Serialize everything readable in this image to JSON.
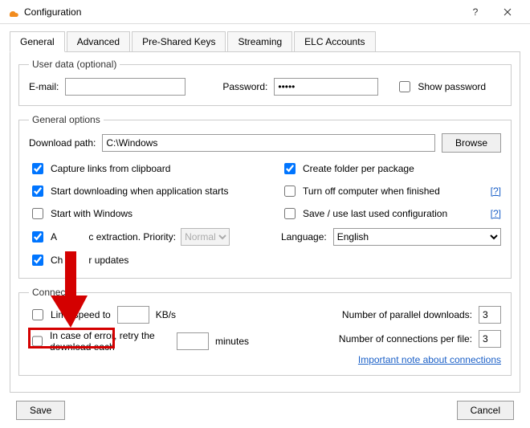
{
  "window": {
    "title": "Configuration"
  },
  "tabs": [
    "General",
    "Advanced",
    "Pre-Shared Keys",
    "Streaming",
    "ELC Accounts"
  ],
  "active_tab": 0,
  "userdata": {
    "legend": "User data (optional)",
    "email_label": "E-mail:",
    "email_value": "",
    "password_label": "Password:",
    "password_value": "•••••",
    "show_password_label": "Show password",
    "show_password_checked": false
  },
  "general": {
    "legend": "General options",
    "download_path_label": "Download path:",
    "download_path_value": "C:\\Windows",
    "browse_label": "Browse",
    "left_opts": [
      {
        "label": "Capture links from clipboard",
        "checked": true
      },
      {
        "label": "Start downloading when application starts",
        "checked": true
      },
      {
        "label": "Start with Windows",
        "checked": false
      }
    ],
    "auto_extract": {
      "label_pre": "A",
      "label_mid": "c extraction. Priority:",
      "checked": true,
      "priority": "Normal",
      "disabled": true
    },
    "check_updates": {
      "label_pre": "Ch",
      "label_post": "r updates",
      "checked": true
    },
    "right_opts": [
      {
        "label": "Create folder per package",
        "checked": true,
        "help": false
      },
      {
        "label": "Turn off computer when finished",
        "checked": false,
        "help": true
      },
      {
        "label": "Save / use last used configuration",
        "checked": false,
        "help": true
      }
    ],
    "language_label": "Language:",
    "language_value": "English"
  },
  "connection": {
    "legend": "Connec",
    "limit_speed": {
      "label": "Limit speed to",
      "checked": false,
      "value": "",
      "unit": "KB/s"
    },
    "retry": {
      "label": "In case of error, retry the download each",
      "checked": false,
      "value": "",
      "unit": "minutes"
    },
    "parallel": {
      "label": "Number of parallel downloads:",
      "value": "3"
    },
    "perfile": {
      "label": "Number of connections per file:",
      "value": "3"
    },
    "note_link": "Important note about connections"
  },
  "footer": {
    "save": "Save",
    "cancel": "Cancel"
  },
  "help_glyph": "[?]"
}
